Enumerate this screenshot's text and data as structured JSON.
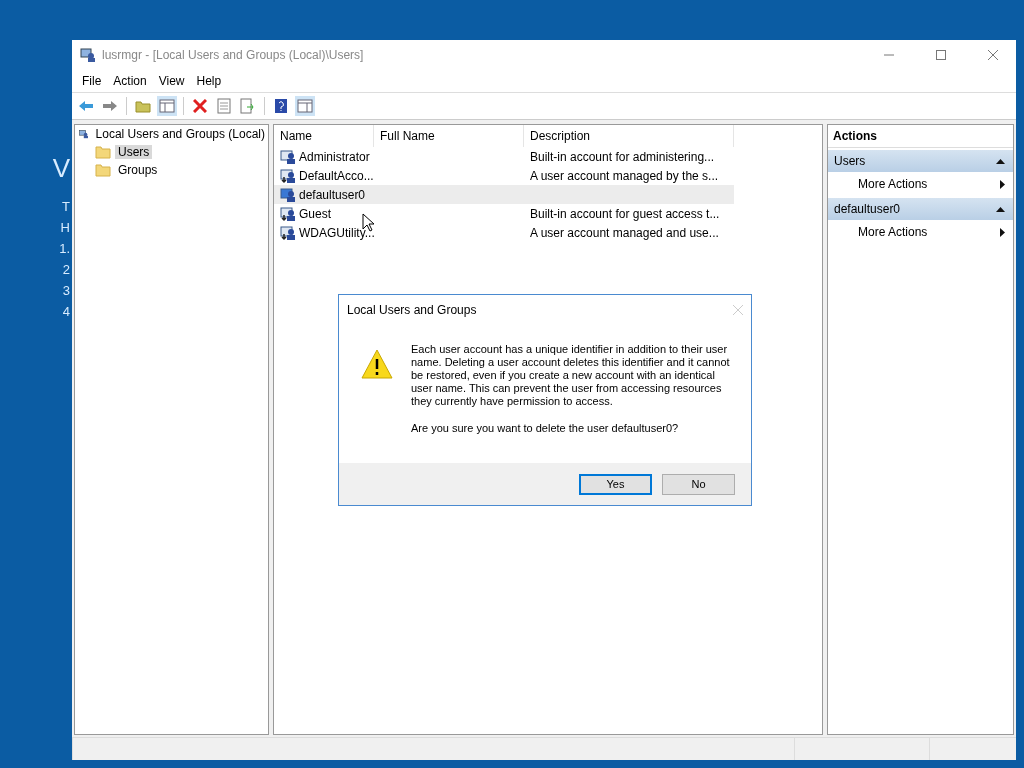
{
  "desktop_text": [
    {
      "text": "V",
      "kind": "heading"
    },
    {
      "text": "T",
      "kind": "line"
    },
    {
      "text": "H",
      "kind": "line"
    },
    {
      "text": "1.",
      "kind": "line"
    },
    {
      "text": "2",
      "kind": "line"
    },
    {
      "text": "3",
      "kind": "line"
    },
    {
      "text": "4",
      "kind": "line"
    }
  ],
  "window": {
    "title": "lusrmgr - [Local Users and Groups (Local)\\Users]"
  },
  "menu": [
    "File",
    "Action",
    "View",
    "Help"
  ],
  "tree": {
    "label": "Local Users and Groups (Local)",
    "children": [
      {
        "label": "Users",
        "selected": true
      },
      {
        "label": "Groups",
        "selected": false
      }
    ]
  },
  "table": {
    "columns": [
      "Name",
      "Full Name",
      "Description"
    ],
    "rows": [
      {
        "name": "Administrator",
        "description": "Built-in account for administering...",
        "disabled": false,
        "selected": false
      },
      {
        "name": "DefaultAcco...",
        "description": "A user account managed by the s...",
        "disabled": true,
        "selected": false
      },
      {
        "name": "defaultuser0",
        "disabled": false,
        "selected": true
      },
      {
        "name": "Guest",
        "description": "Built-in account for guest access t...",
        "disabled": true,
        "selected": false
      },
      {
        "name": "WDAGUtility...",
        "description": "A user account managed and use...",
        "disabled": true,
        "selected": false
      }
    ]
  },
  "actions": {
    "title": "Actions",
    "sections": [
      {
        "title": "Users",
        "expanded": true,
        "items": [
          "More Actions"
        ]
      },
      {
        "title": "defaultuser0",
        "expanded": true,
        "items": [
          "More Actions"
        ]
      }
    ]
  },
  "dialog": {
    "title": "Local Users and Groups",
    "message": "Each user account has a unique identifier in addition to their user name. Deleting a user account deletes this identifier and it cannot be restored, even if you create a new account with an identical user name. This can prevent the user from accessing resources they currently have permission to access.",
    "question": "Are you sure you want to delete the user defaultuser0?",
    "buttons": [
      {
        "label": "Yes",
        "default": true
      },
      {
        "label": "No",
        "default": false
      }
    ]
  }
}
